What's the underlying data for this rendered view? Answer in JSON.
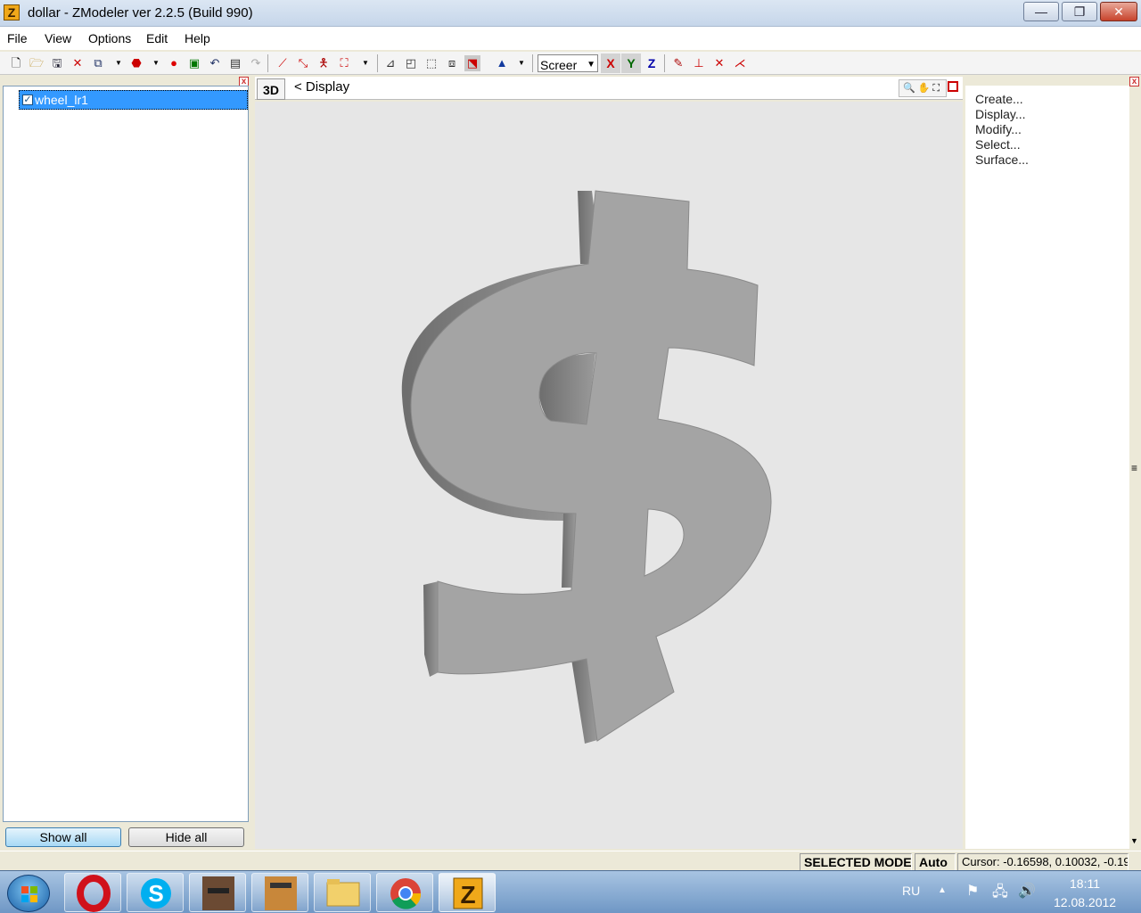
{
  "window": {
    "title": "dollar - ZModeler ver 2.2.5 (Build 990)",
    "app_icon_letter": "Z",
    "minimize_glyph": "—",
    "maximize_glyph": "❐",
    "close_glyph": "✕"
  },
  "menu": {
    "file": "File",
    "view": "View",
    "options": "Options",
    "edit": "Edit",
    "help": "Help"
  },
  "toolbar": {
    "screen_select": "Screer",
    "axis_x": "X",
    "axis_y": "Y",
    "axis_z": "Z",
    "axis_x_color": "#cc0000",
    "axis_y_color": "#006600",
    "axis_z_color": "#0000aa"
  },
  "tree": {
    "items": [
      {
        "label": "wheel_lr1",
        "checked": true
      }
    ],
    "check_glyph": "✓",
    "close_glyph": "x"
  },
  "left_buttons": {
    "show_all": "Show all",
    "hide_all": "Hide all"
  },
  "viewport": {
    "mode_label": "3D",
    "title": "<  Display",
    "tools_glyphs": "🔍✋⛶",
    "background": "#e6e6e6",
    "object_color": "#a4a4a4"
  },
  "right_panel": {
    "items": [
      "Create...",
      "Display...",
      "Modify...",
      "Select...",
      "Surface..."
    ],
    "close_glyph": "x",
    "scroll_mid": "≡",
    "scroll_down": "▼"
  },
  "status": {
    "mode": "SELECTED MODE",
    "auto": "Auto",
    "cursor": "Cursor: -0.16598, 0.10032, -0.19!"
  },
  "taskbar": {
    "lang": "RU",
    "time": "18:11",
    "date": "12.08.2012",
    "tray_arrow": "▲"
  }
}
